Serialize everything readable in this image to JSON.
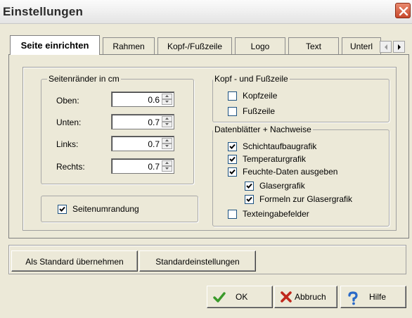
{
  "window": {
    "title": "Einstellungen"
  },
  "tabs": [
    {
      "label": "Seite einrichten"
    },
    {
      "label": "Rahmen"
    },
    {
      "label": "Kopf-/Fußzeile"
    },
    {
      "label": "Logo"
    },
    {
      "label": "Text"
    },
    {
      "label": "Unterl"
    }
  ],
  "margins_group": {
    "title": "Seitenränder in cm",
    "fields": [
      {
        "label": "Oben:",
        "value": "0.6"
      },
      {
        "label": "Unten:",
        "value": "0.7"
      },
      {
        "label": "Links:",
        "value": "0.7"
      },
      {
        "label": "Rechts:",
        "value": "0.7"
      }
    ]
  },
  "border_checkbox": {
    "label": "Seitenumrandung",
    "checked": true
  },
  "header_footer_group": {
    "title": "Kopf - und Fußzeile",
    "items": [
      {
        "label": "Kopfzeile",
        "checked": false
      },
      {
        "label": "Fußzeile",
        "checked": false
      }
    ]
  },
  "datasheets_group": {
    "title": "Datenblätter + Nachweise",
    "items": [
      {
        "label": "Schichtaufbaugrafik",
        "checked": true
      },
      {
        "label": "Temperaturgrafik",
        "checked": true
      },
      {
        "label": "Feuchte-Daten ausgeben",
        "checked": true
      },
      {
        "label": "Glasergrafik",
        "checked": true
      },
      {
        "label": "Formeln zur Glasergrafik",
        "checked": true
      },
      {
        "label": "Texteingabefelder",
        "checked": false
      }
    ]
  },
  "buttons": {
    "set_default": "Als Standard übernehmen",
    "defaults": "Standardeinstellungen",
    "ok": "OK",
    "cancel": "Abbruch",
    "help": "Hilfe"
  },
  "colors": {
    "checkmark": "#000000",
    "ok_icon": "#3a9a2a",
    "cancel_icon": "#c0281c",
    "help_icon": "#2a6ac8"
  }
}
